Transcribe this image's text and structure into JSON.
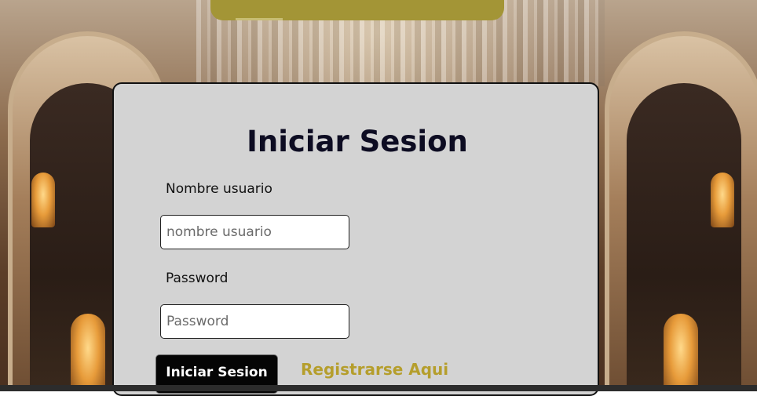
{
  "login": {
    "title": "Iniciar Sesion",
    "username_label": "Nombre usuario",
    "username_placeholder": "nombre usuario",
    "password_label": "Password",
    "password_placeholder": "Password",
    "submit_label": "Iniciar Sesion",
    "register_link": "Registrarse Aqui"
  },
  "colors": {
    "card_background": "#d3d3d3",
    "accent_gold": "#b59e2c",
    "top_bar": "#a39536",
    "button_background": "#050505"
  }
}
